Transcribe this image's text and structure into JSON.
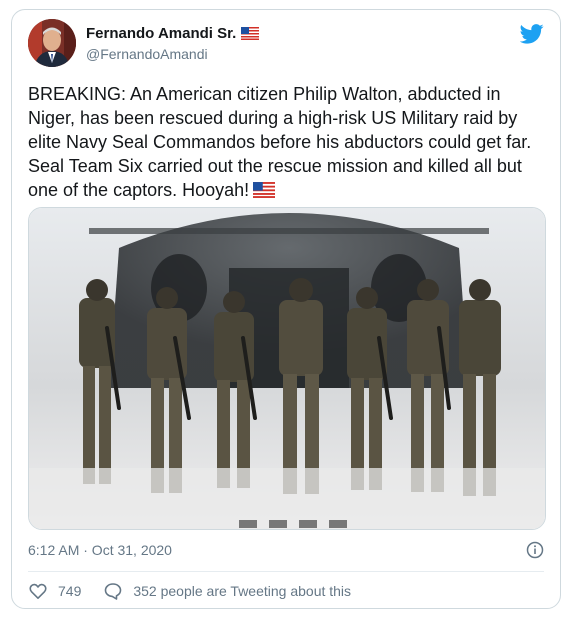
{
  "user": {
    "display_name": "Fernando Amandi Sr.",
    "handle": "@FernandoAmandi"
  },
  "tweet": {
    "text": "BREAKING: An American citizen Philip Walton, abducted in Niger, has been rescued during a high-risk US Military raid by elite Navy Seal Commandos before his abductors could get far. Seal Team Six carried out the rescue mission and killed all but one of the captors. Hooyah!",
    "emoji": "us-flag-emoji",
    "timestamp": "6:12 AM · Oct 31, 2020"
  },
  "actions": {
    "likes": "749",
    "conversation": "352 people are Tweeting about this"
  },
  "icons": {
    "brand": "twitter-bird-icon",
    "info": "info-icon",
    "like": "heart-icon",
    "reply": "speech-bubble-icon",
    "name_badge": "us-flag-emoji"
  },
  "colors": {
    "brand_blue": "#1da1f2",
    "text_primary": "#14171a",
    "text_secondary": "#657786",
    "border": "#cfd9de"
  }
}
